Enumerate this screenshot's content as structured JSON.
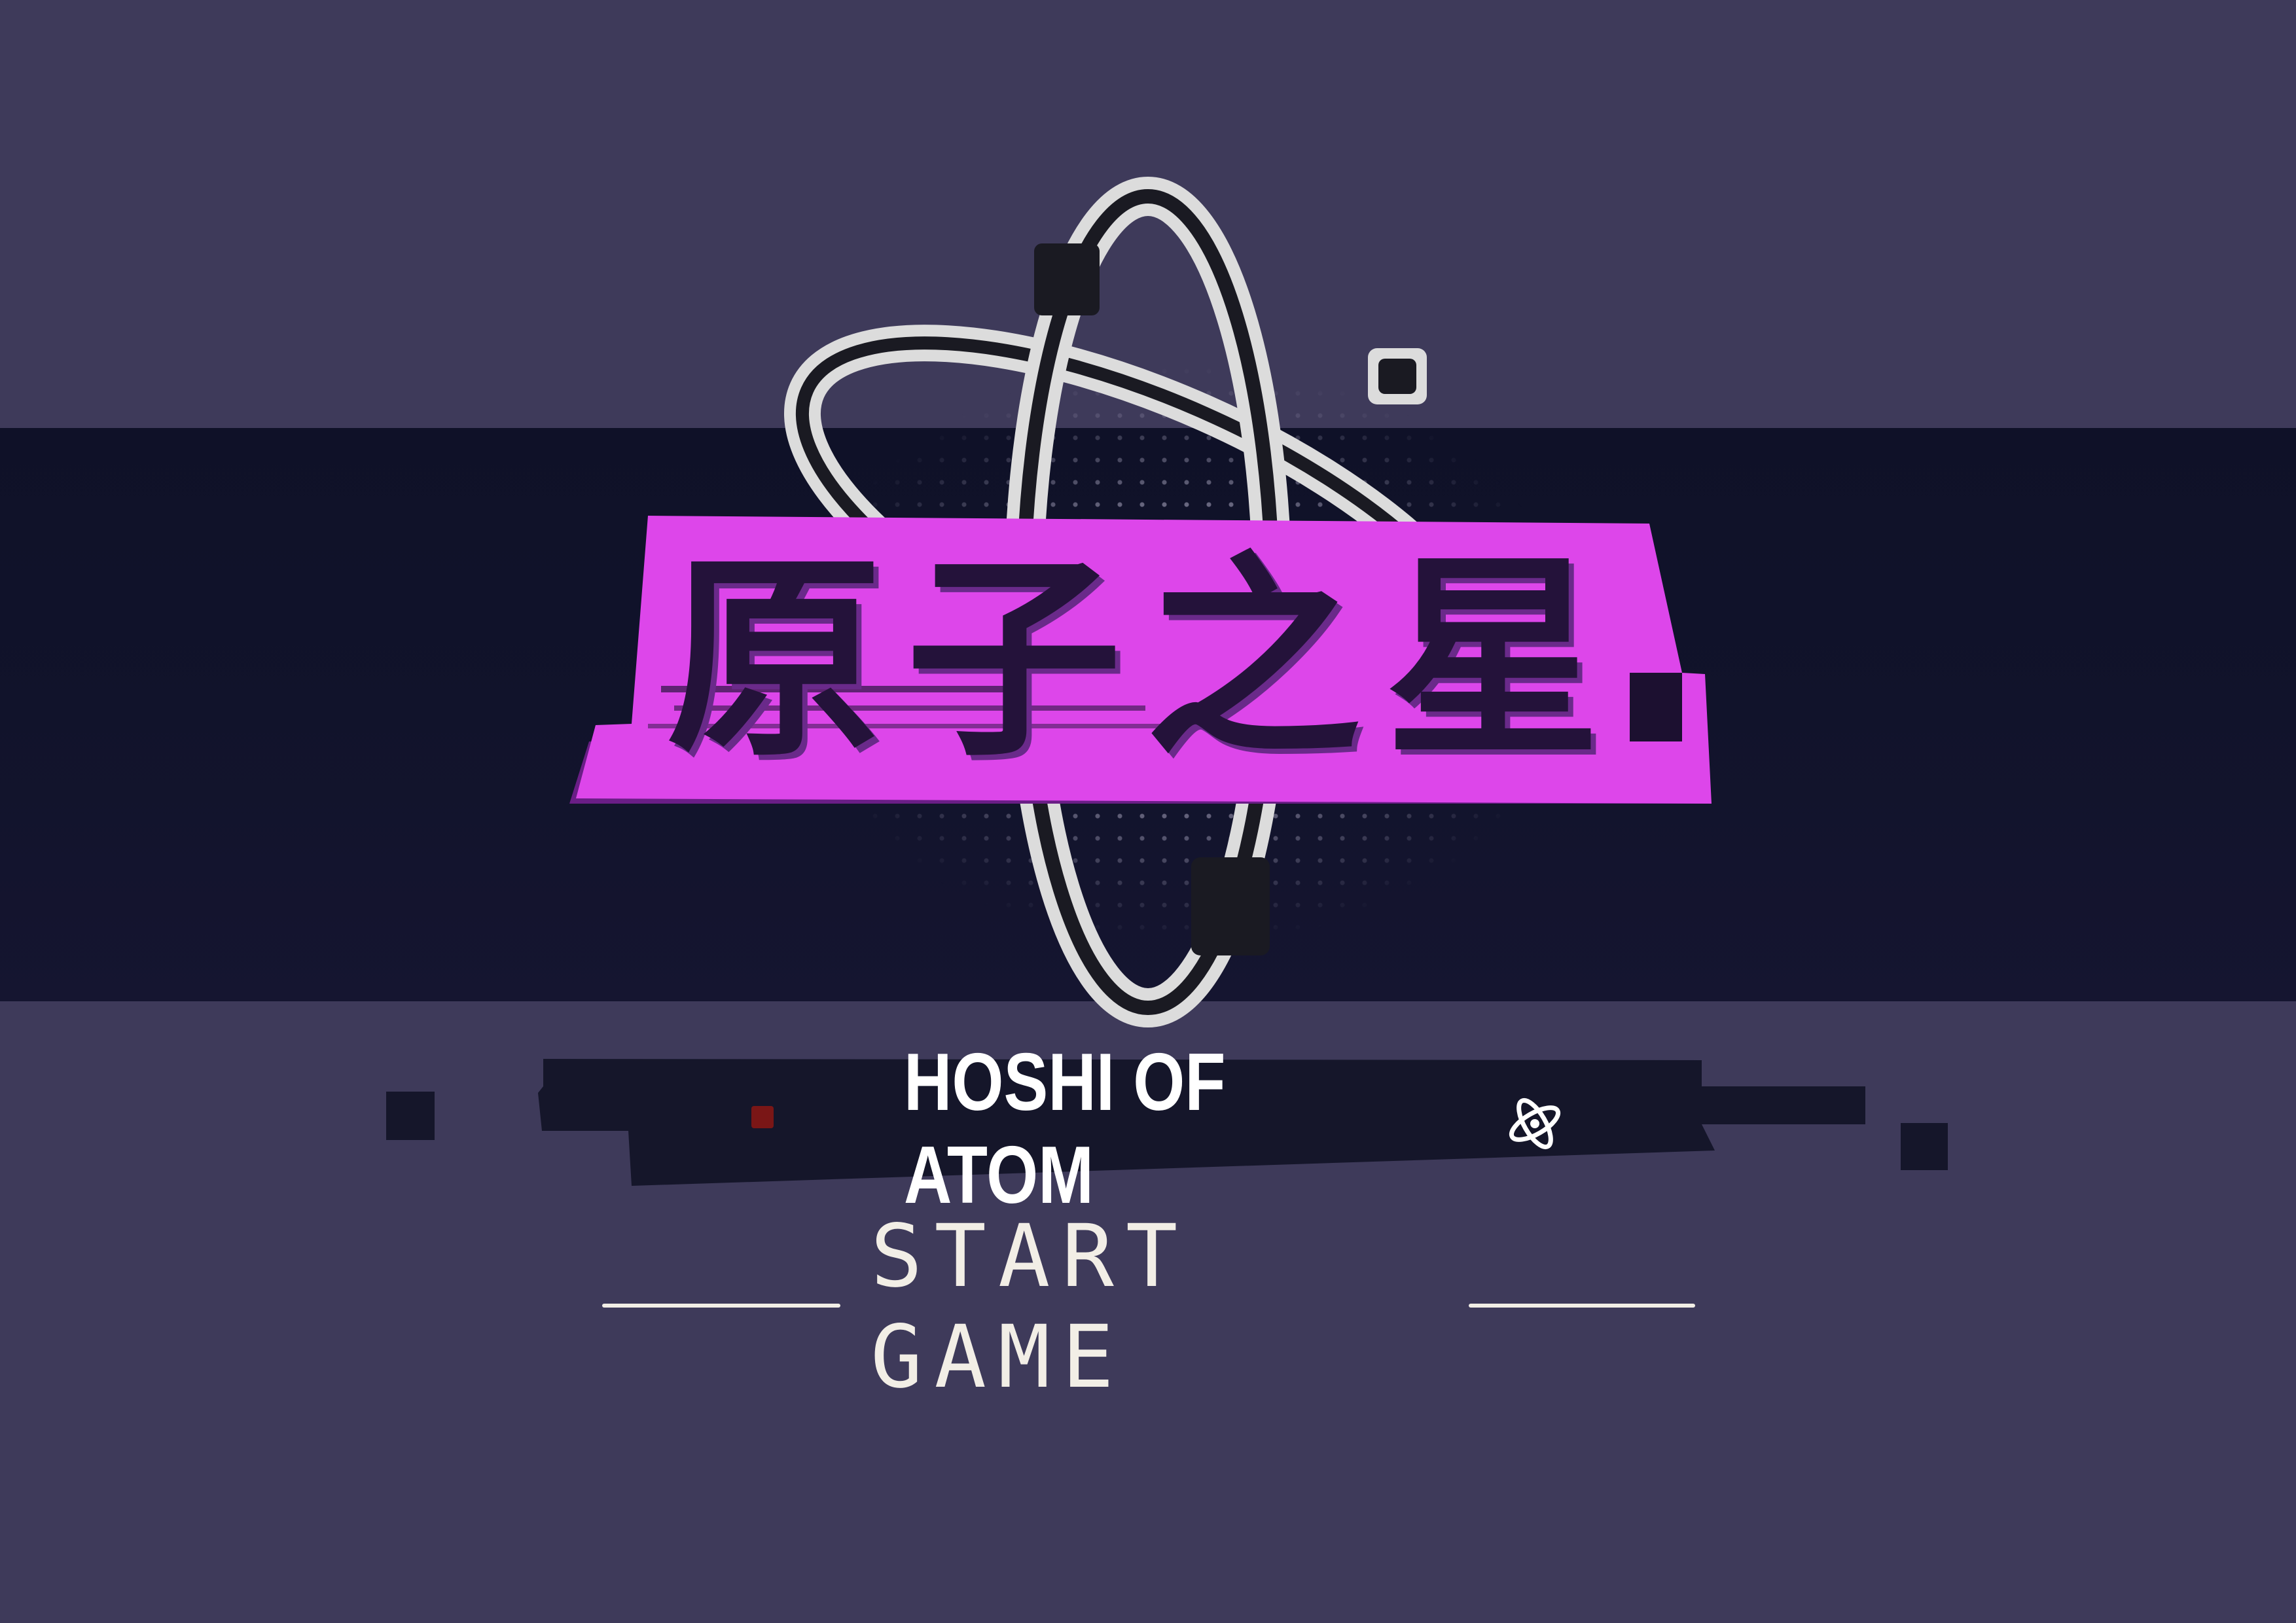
{
  "logo": {
    "title": "原子之星"
  },
  "subtitle": {
    "text": "HOSHI OF ATOM"
  },
  "menu": {
    "start_label": "START GAME"
  },
  "icons": [
    "atom-icon",
    "mini-atom-icon"
  ],
  "colors": {
    "background": "#3e3a5a",
    "band": "#11132b",
    "magenta": "#dd46ea",
    "title_text": "#24123a",
    "subtitle_text": "#ffffff",
    "menu_text": "#f2eee6"
  }
}
